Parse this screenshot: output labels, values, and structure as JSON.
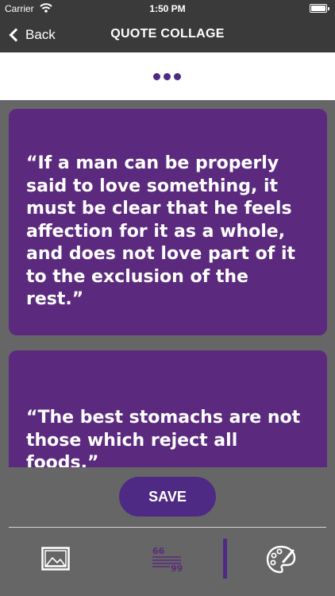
{
  "status_bar": {
    "carrier": "Carrier",
    "time": "1:50 PM",
    "battery_level": 1.0
  },
  "nav": {
    "back_label": "Back",
    "title": "QUOTE COLLAGE"
  },
  "quotes": [
    {
      "text": "“If a man can be properly said to love something, it must be clear that he feels affection for it as a whole, and does not love part of it to the exclusion of the rest.”"
    },
    {
      "text": "“The best stomachs are not those which reject all foods.”"
    }
  ],
  "bottom": {
    "save_label": "SAVE"
  },
  "colors": {
    "accent_purple": "#4e2a84",
    "card_purple": "#5b2a7e",
    "nav_background": "#3a3a3a",
    "panel_gray": "#666666"
  },
  "icons": [
    "wifi-icon",
    "battery-icon",
    "back-chevron-icon",
    "more-dots-icon",
    "image-icon",
    "quotes-icon",
    "palette-icon"
  ]
}
